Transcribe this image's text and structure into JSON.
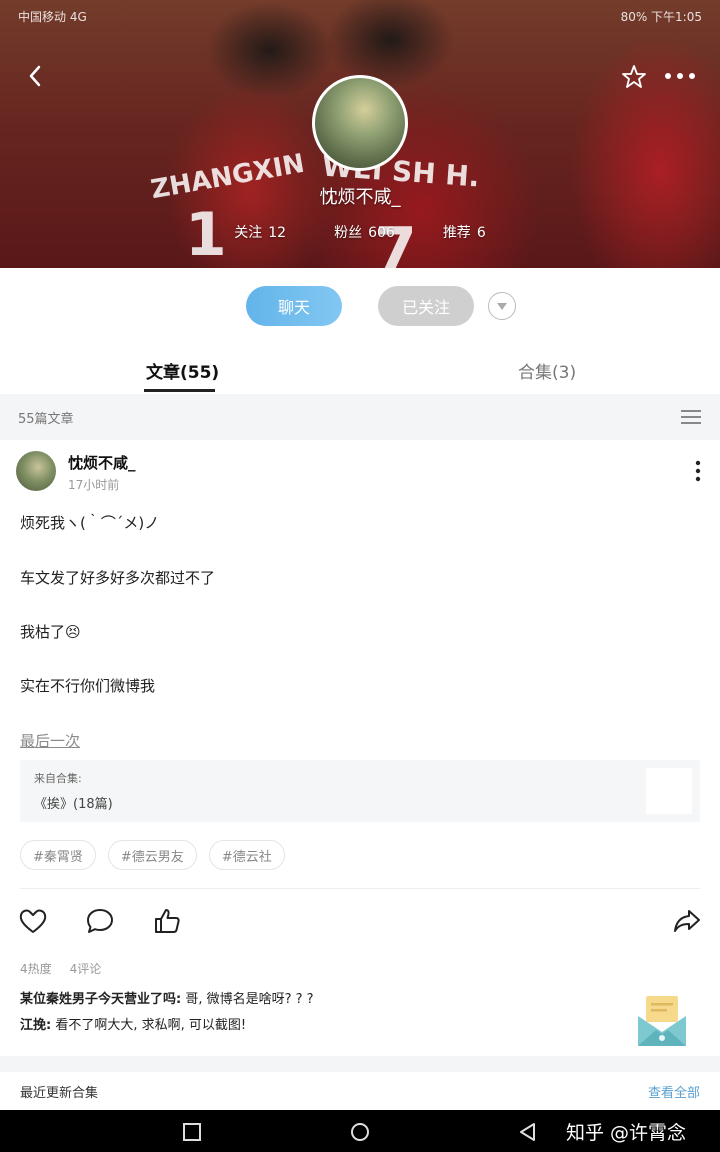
{
  "status_bar": {
    "carrier": "中国移动 4G",
    "right_text": "80% 下午1:05"
  },
  "banner": {
    "jersey_text_left": "ZHANGXIN",
    "jersey_text_mid": "WEI SH H.",
    "jersey_number_left": "1",
    "jersey_number_mid": "7"
  },
  "profile": {
    "name": "忱烦不咸_",
    "stats": [
      {
        "label": "关注",
        "value": "12"
      },
      {
        "label": "粉丝",
        "value": "606"
      },
      {
        "label": "推荐",
        "value": "6"
      }
    ]
  },
  "actions": {
    "chat_label": "聊天",
    "follow_label": "已关注"
  },
  "tabs": [
    {
      "label": "文章(55)",
      "active": true
    },
    {
      "label": "合集(3)",
      "active": false
    }
  ],
  "subheader": {
    "count_text": "55篇文章"
  },
  "post": {
    "author": "忱烦不咸_",
    "time": "17小时前",
    "lines": [
      "烦死我ヽ(｀⌒´メ)ノ",
      "车文发了好多好多次都过不了",
      "我枯了😣",
      "实在不行你们微博我"
    ],
    "last_link": "最后一次",
    "collection_from": "来自合集:",
    "collection_title": "《挨》(18篇)",
    "tags": [
      "#秦霄贤",
      "#德云男友",
      "#德云社"
    ],
    "metrics": [
      "4热度",
      "4评论"
    ],
    "comments": [
      {
        "user": "某位秦姓男子今天营业了吗:",
        "text": " 哥, 微博名是啥呀? ? ?"
      },
      {
        "user": "江挽:",
        "text": " 看不了啊大大, 求私啊, 可以截图!"
      }
    ]
  },
  "footer": {
    "title": "最近更新合集",
    "link": "查看全部"
  },
  "watermark": "知乎 @许霄念",
  "colors": {
    "accent_blue": "#63b4ea",
    "followed_gray": "#cfcfcf",
    "link_blue": "#5aa0cf"
  },
  "icons": [
    "back-icon",
    "star-icon",
    "more-icon",
    "dropdown-icon",
    "list-icon",
    "kebab-icon",
    "heart-icon",
    "comment-icon",
    "thumbs-up-icon",
    "share-icon",
    "mail-icon"
  ]
}
